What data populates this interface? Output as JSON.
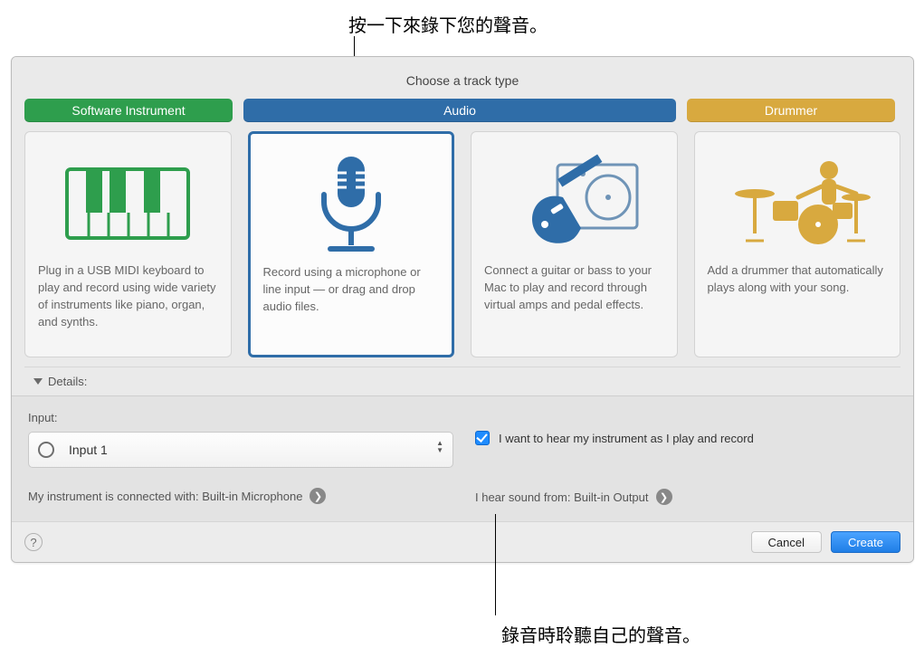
{
  "annotations": {
    "top": "按一下來錄下您的聲音。",
    "bottom": "錄音時聆聽自己的聲音。"
  },
  "title": "Choose a track type",
  "tabs": {
    "software": "Software Instrument",
    "audio": "Audio",
    "drummer": "Drummer"
  },
  "cards": [
    {
      "desc": "Plug in a USB MIDI keyboard to play and record using wide variety of instruments like piano, organ, and synths."
    },
    {
      "desc": "Record using a microphone or line input — or drag and drop audio files."
    },
    {
      "desc": "Connect a guitar or bass to your Mac to play and record through virtual amps and pedal effects."
    },
    {
      "desc": "Add a drummer that automatically plays along with your song."
    }
  ],
  "details_label": "Details:",
  "input": {
    "label": "Input:",
    "value": "Input 1",
    "connected_prefix": "My instrument is connected with: ",
    "connected_value": "Built-in Microphone"
  },
  "monitor": {
    "checkbox_label": "I want to hear my instrument as I play and record",
    "output_prefix": "I hear sound from: ",
    "output_value": "Built-in Output"
  },
  "buttons": {
    "cancel": "Cancel",
    "create": "Create"
  }
}
